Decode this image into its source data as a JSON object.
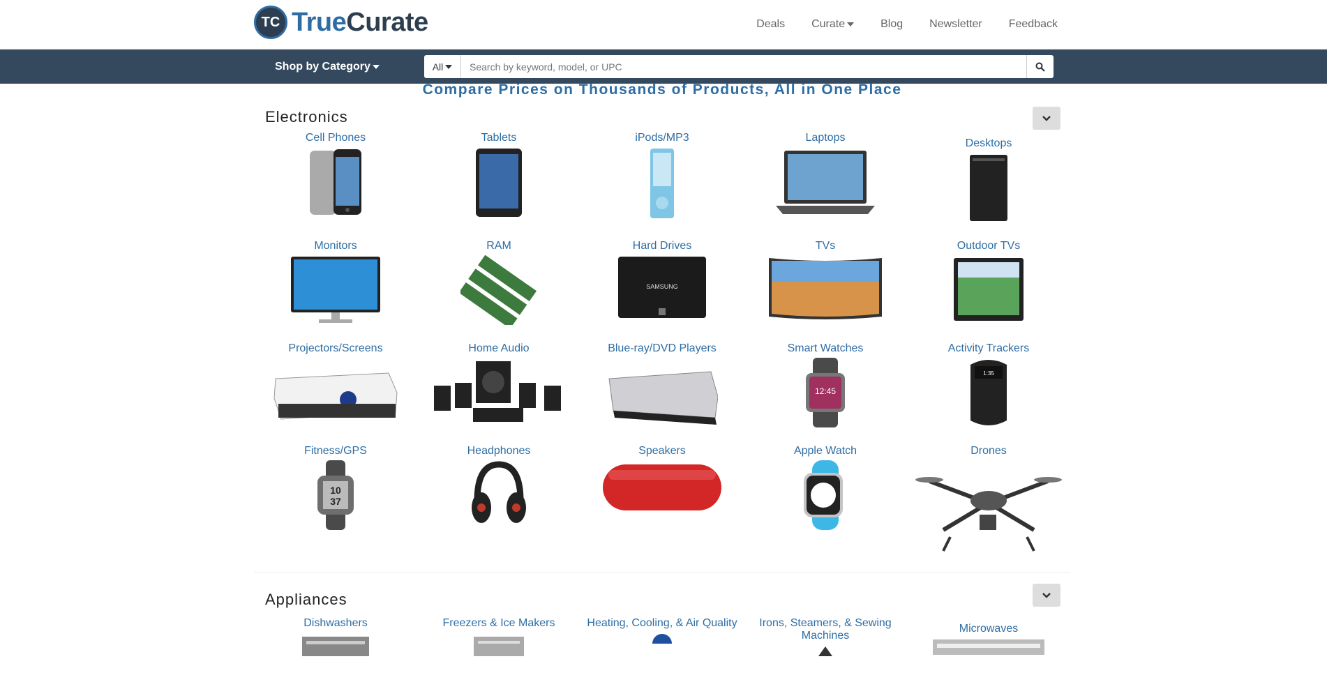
{
  "header": {
    "logo_badge": "TC",
    "logo_true": "True",
    "logo_curate": "Curate",
    "nav": [
      {
        "label": "Deals"
      },
      {
        "label": "Curate"
      },
      {
        "label": "Blog"
      },
      {
        "label": "Newsletter"
      },
      {
        "label": "Feedback"
      }
    ]
  },
  "searchbar": {
    "shop_by_category": "Shop by Category",
    "scope": "All",
    "placeholder": "Search by keyword, model, or UPC"
  },
  "tagline": "Compare Prices on Thousands of Products, All in One Place",
  "sections": [
    {
      "title": "Electronics",
      "items": [
        {
          "label": "Cell Phones"
        },
        {
          "label": "Tablets"
        },
        {
          "label": "iPods/MP3"
        },
        {
          "label": "Laptops"
        },
        {
          "label": "Desktops"
        },
        {
          "label": "Monitors"
        },
        {
          "label": "RAM"
        },
        {
          "label": "Hard Drives"
        },
        {
          "label": "TVs"
        },
        {
          "label": "Outdoor TVs"
        },
        {
          "label": "Projectors/Screens"
        },
        {
          "label": "Home Audio"
        },
        {
          "label": "Blue-ray/DVD Players"
        },
        {
          "label": "Smart Watches"
        },
        {
          "label": "Activity Trackers"
        },
        {
          "label": "Fitness/GPS"
        },
        {
          "label": "Headphones"
        },
        {
          "label": "Speakers"
        },
        {
          "label": "Apple Watch"
        },
        {
          "label": "Drones"
        }
      ]
    },
    {
      "title": "Appliances",
      "items": [
        {
          "label": "Dishwashers"
        },
        {
          "label": "Freezers & Ice Makers"
        },
        {
          "label": "Heating, Cooling, & Air Quality"
        },
        {
          "label": "Irons, Steamers, & Sewing Machines"
        },
        {
          "label": "Microwaves"
        }
      ]
    }
  ],
  "colors": {
    "brand": "#2e6da4",
    "bar": "#34495e",
    "link": "#2e6da4"
  }
}
